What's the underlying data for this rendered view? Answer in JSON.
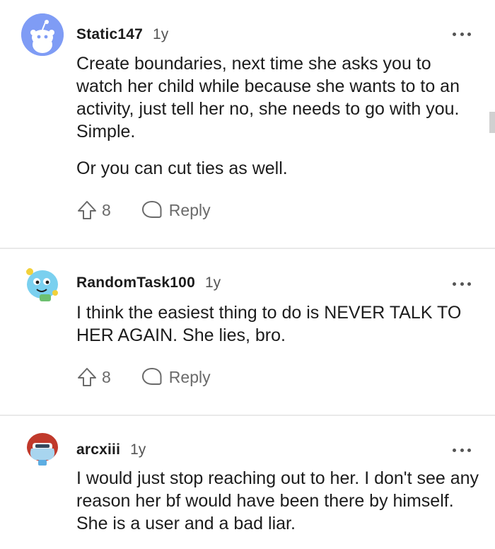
{
  "comments": [
    {
      "username": "Static147",
      "age": "1y",
      "paragraphs": [
        "Create boundaries, next time she asks you to watch her child while because she wants to to an activity, just tell her no, she needs to go with you. Simple.",
        "Or you can cut ties as well."
      ],
      "votes": "8",
      "reply_label": "Reply",
      "avatar_color": "#7f9cf5"
    },
    {
      "username": "RandomTask100",
      "age": "1y",
      "paragraphs": [
        "I think the easiest thing to do is NEVER TALK TO HER AGAIN. She lies, bro."
      ],
      "votes": "8",
      "reply_label": "Reply",
      "avatar_color": "#6ec3e8"
    },
    {
      "username": "arcxiii",
      "age": "1y",
      "paragraphs": [
        "I would just stop reaching out to her. I don't see any reason her bf would have been there by himself. She is a user and a bad liar."
      ],
      "avatar_color": "#c0392b"
    }
  ],
  "icons": {
    "more": "more-options-icon",
    "upvote": "upvote-arrow-icon",
    "reply": "comment-bubble-icon"
  }
}
